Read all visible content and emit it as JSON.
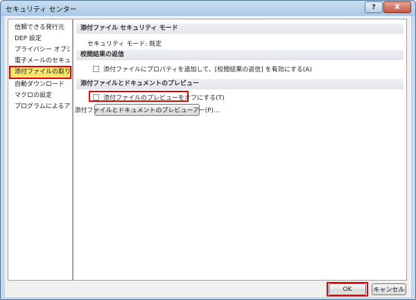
{
  "window": {
    "title": "セキュリティ センター",
    "help_glyph": "?",
    "close_glyph": "X"
  },
  "sidebar": {
    "items": [
      {
        "label": "信頼できる発行元"
      },
      {
        "label": "DEP 設定"
      },
      {
        "label": "プライバシー オプション"
      },
      {
        "label": "電子メールのセキュリティ"
      },
      {
        "label": "添付ファイルの取り扱い",
        "selected": true
      },
      {
        "label": "自動ダウンロード"
      },
      {
        "label": "マクロの設定"
      },
      {
        "label": "プログラムによるアクセス"
      }
    ]
  },
  "content": {
    "section1": {
      "header": "添付ファイル セキュリティ モード",
      "mode_text": "セキュリティ モード: 既定"
    },
    "section2": {
      "header": "校閲結果の返信",
      "checkbox_label": "添付ファイルにプロパティを追加して、[校閲結果の返信] を有効にする(A)",
      "checked": false
    },
    "section3": {
      "header": "添付ファイルとドキュメントのプレビュー",
      "checkbox_label": "添付ファイルのプレビューをオフにする(T)",
      "checked": false,
      "button_label": "添付ファイルとドキュメントのプレビューアー(P)..."
    }
  },
  "footer": {
    "ok_label": "OK",
    "cancel_label": "キャンセル"
  },
  "colors": {
    "highlight_red": "#e30000",
    "selected_yellow": "#f8e56b"
  }
}
